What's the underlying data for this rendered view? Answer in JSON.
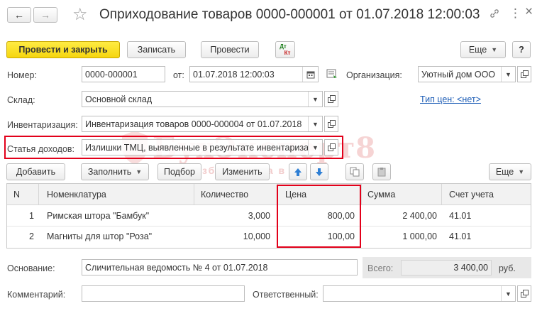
{
  "window": {
    "title": "Оприходование товаров 0000-000001 от 01.07.2018 12:00:03",
    "back_glyph": "←",
    "forward_glyph": "→",
    "star_glyph": "☆",
    "link_glyph": "🔗",
    "menu_glyph": "⋮",
    "close_glyph": "×"
  },
  "toolbar": {
    "post_close": "Провести и закрыть",
    "save": "Записать",
    "post": "Провести",
    "dtkt_top": "Дт",
    "dtkt_bottom": "Кт",
    "more": "Еще",
    "help": "?"
  },
  "form": {
    "number_label": "Номер:",
    "number_value": "0000-000001",
    "date_label": "от:",
    "date_value": "01.07.2018 12:00:03",
    "org_label": "Организация:",
    "org_value": "Уютный дом ООО",
    "warehouse_label": "Склад:",
    "warehouse_value": "Основной склад",
    "price_type_link": "Тип цен: <нет>",
    "inventory_label": "Инвентаризация:",
    "inventory_value": "Инвентаризация товаров 0000-000004 от 01.07.2018",
    "income_label": "Статья доходов:",
    "income_value": "Излишки ТМЦ, выявленные в результате инвентаризации"
  },
  "table_toolbar": {
    "add": "Добавить",
    "fill": "Заполнить",
    "select": "Подбор",
    "change": "Изменить",
    "more": "Еще"
  },
  "table": {
    "columns": [
      "N",
      "Номенклатура",
      "Количество",
      "Цена",
      "Сумма",
      "Счет учета"
    ],
    "rows": [
      {
        "n": "1",
        "name": "Римская штора \"Бамбук\"",
        "qty": "3,000",
        "price": "800,00",
        "sum": "2 400,00",
        "account": "41.01"
      },
      {
        "n": "2",
        "name": "Магниты для штор \"Роза\"",
        "qty": "10,000",
        "price": "100,00",
        "sum": "1 000,00",
        "account": "41.01"
      }
    ]
  },
  "footer": {
    "basis_label": "Основание:",
    "basis_value": "Сличительная ведомость № 4 от 01.07.2018",
    "total_label": "Всего:",
    "total_value": "3 400,00",
    "currency": "руб.",
    "comment_label": "Комментарий:",
    "comment_value": "",
    "responsible_label": "Ответственный:",
    "responsible_value": ""
  },
  "watermark": {
    "brand": "БухЭксперт8",
    "tagline": "азбука учета в 1С"
  }
}
